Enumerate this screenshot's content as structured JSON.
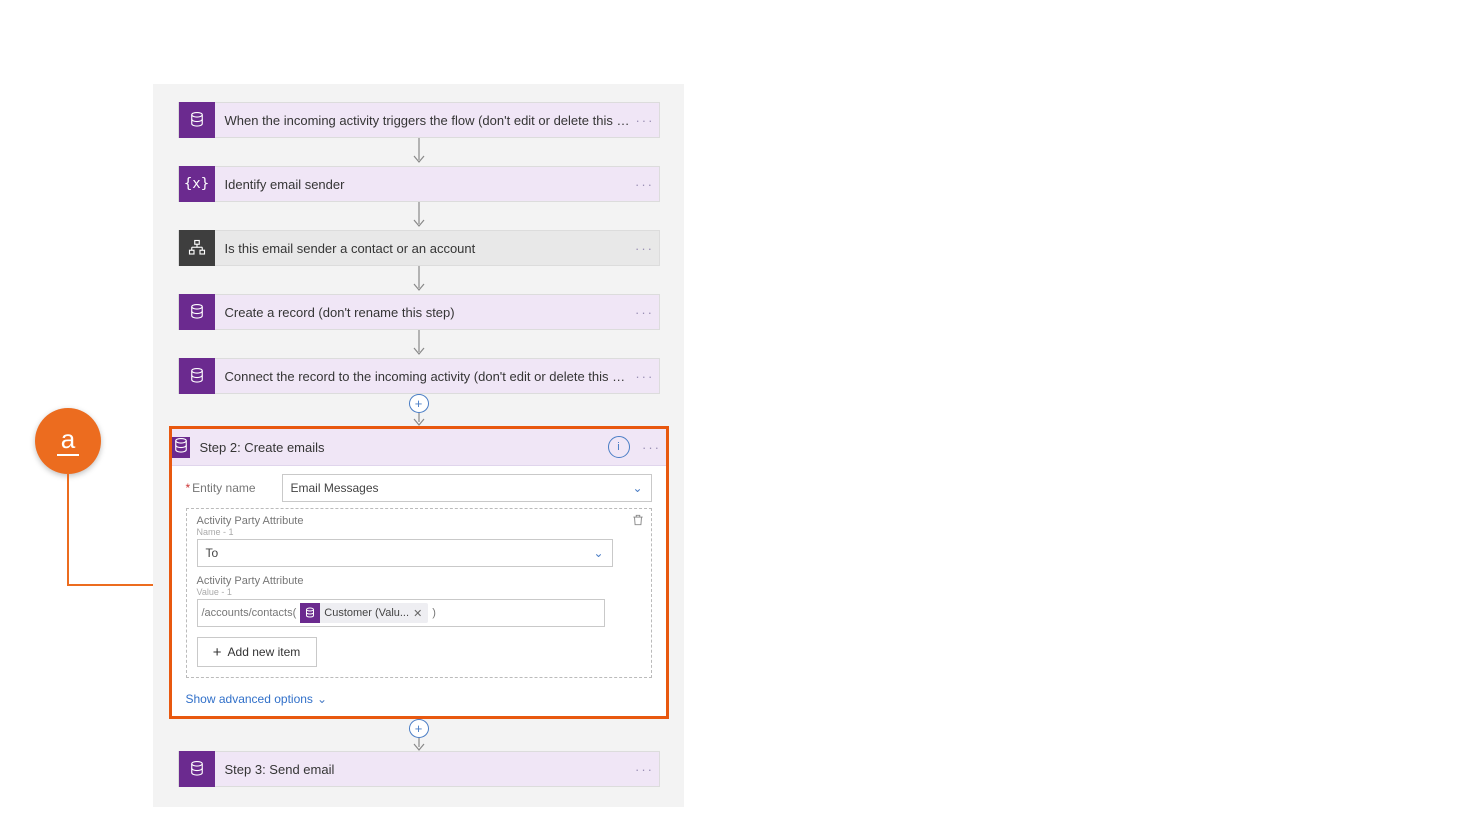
{
  "annotation": {
    "badge_letter": "a"
  },
  "steps": {
    "trigger": {
      "label": "When the incoming activity triggers the flow (don't edit or delete this step)"
    },
    "identify": {
      "label": "Identify email sender"
    },
    "branch": {
      "label": "Is this email sender a contact or an account"
    },
    "create": {
      "label": "Create a record (don't rename this step)"
    },
    "connect": {
      "label": "Connect the record to the incoming activity (don't edit or delete this step)"
    },
    "step2": {
      "label": "Step 2: Create emails"
    },
    "step3": {
      "label": "Step 3: Send email"
    }
  },
  "step2_body": {
    "entity_label": "Entity name",
    "entity_value": "Email Messages",
    "attr_name_label": "Activity Party Attribute",
    "attr_name_sub": "Name - 1",
    "attr_name_value": "To",
    "attr_value_label": "Activity Party Attribute",
    "attr_value_sub": "Value - 1",
    "attr_value_prefix": "/accounts/contacts(",
    "attr_value_token": "Customer (Valu...",
    "attr_value_suffix": ")",
    "add_item": "Add new item",
    "advanced": "Show advanced options"
  }
}
